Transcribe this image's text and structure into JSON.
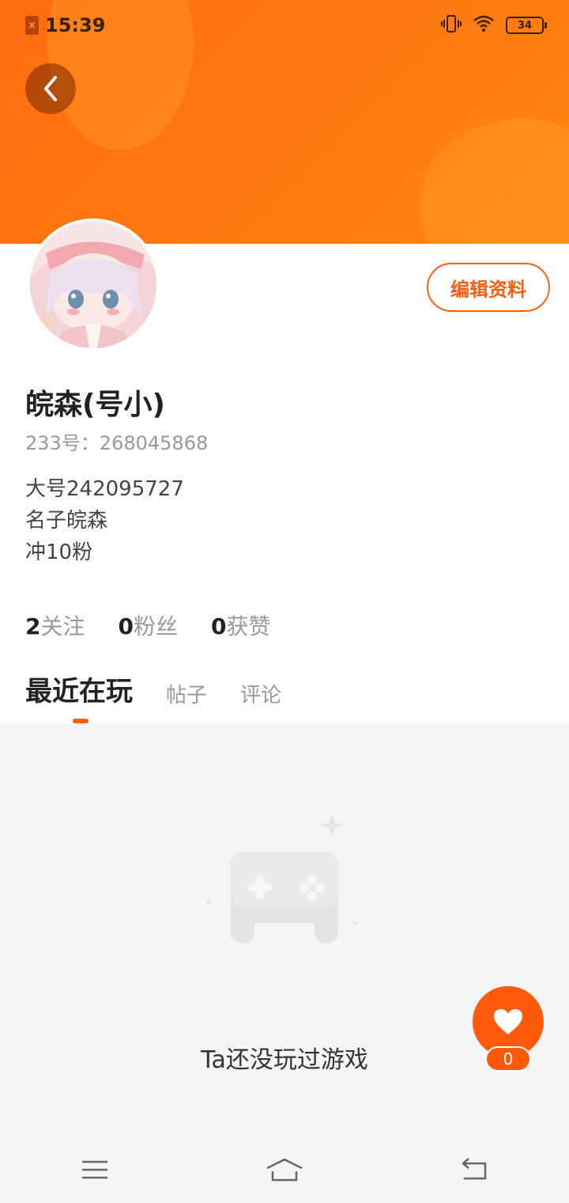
{
  "status_bar": {
    "time": "15:39",
    "battery_level": "34",
    "icons": [
      "sim-warning-icon",
      "vibrate-icon",
      "wifi-icon",
      "battery-icon"
    ]
  },
  "header": {
    "back_icon": "chevron-left-icon",
    "edit_profile_label": "编辑资料"
  },
  "profile": {
    "nickname": "皖森(号小)",
    "uid_text": "233号：268045868",
    "bio": [
      "大号242095727",
      "名子皖森",
      "冲10粉"
    ]
  },
  "stats": [
    {
      "count": "2",
      "label": "关注"
    },
    {
      "count": "0",
      "label": "粉丝"
    },
    {
      "count": "0",
      "label": "获赞"
    }
  ],
  "tabs": [
    {
      "label": "最近在玩",
      "active": true
    },
    {
      "label": "帖子",
      "active": false
    },
    {
      "label": "评论",
      "active": false
    }
  ],
  "empty_state": {
    "icon": "gamepad-icon",
    "text": "Ta还没玩过游戏"
  },
  "like_fab": {
    "icon": "heart-icon",
    "count": "0"
  },
  "colors": {
    "accent": "#ff5e0e",
    "header_gradient_start": "#ff6d12",
    "header_gradient_end": "#ff8612",
    "page_bg": "#f5f5f5"
  },
  "nav_bar": {
    "icons": [
      "menu-icon",
      "home-icon",
      "back-icon"
    ]
  }
}
